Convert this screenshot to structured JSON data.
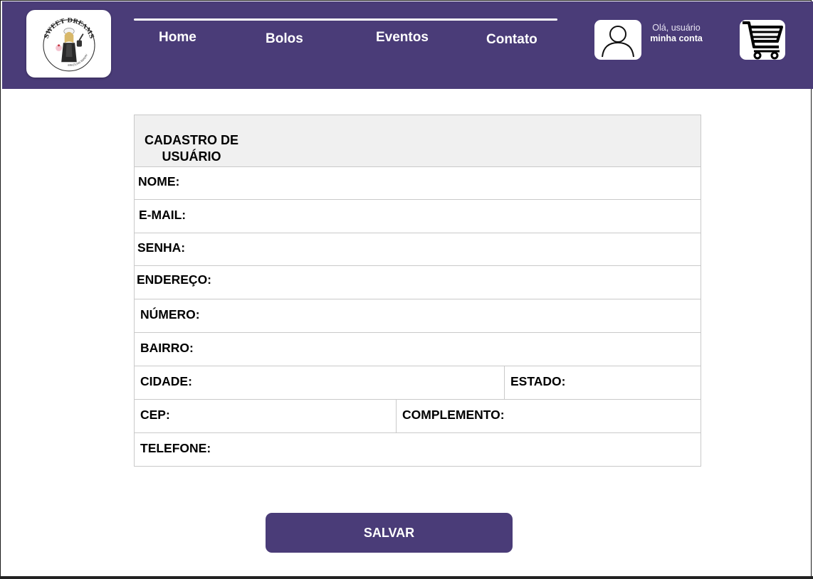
{
  "brand": {
    "logo_text_top": "SWEET DREAMS",
    "logo_text_bottom": "BRAZILIAN BAKERY",
    "accent": "#4a3c78"
  },
  "nav": {
    "home": "Home",
    "bolos": "Bolos",
    "eventos": "Eventos",
    "contato": "Contato"
  },
  "account": {
    "greeting": "Olá, usuário",
    "link": "minha conta",
    "icon": "user-icon"
  },
  "cart": {
    "icon": "shopping-cart-icon"
  },
  "form": {
    "title_line1": "CADASTRO DE",
    "title_line2": "USUÁRIO",
    "fields": {
      "nome": "NOME:",
      "email": "E-MAIL:",
      "senha": "SENHA:",
      "endereco": "ENDEREÇO:",
      "numero": "NÚMERO:",
      "bairro": "BAIRRO:",
      "cidade": "CIDADE:",
      "estado": "ESTADO:",
      "cep": "CEP:",
      "complemento": "COMPLEMENTO:",
      "telefone": "TELEFONE:"
    }
  },
  "actions": {
    "save": "SALVAR"
  }
}
